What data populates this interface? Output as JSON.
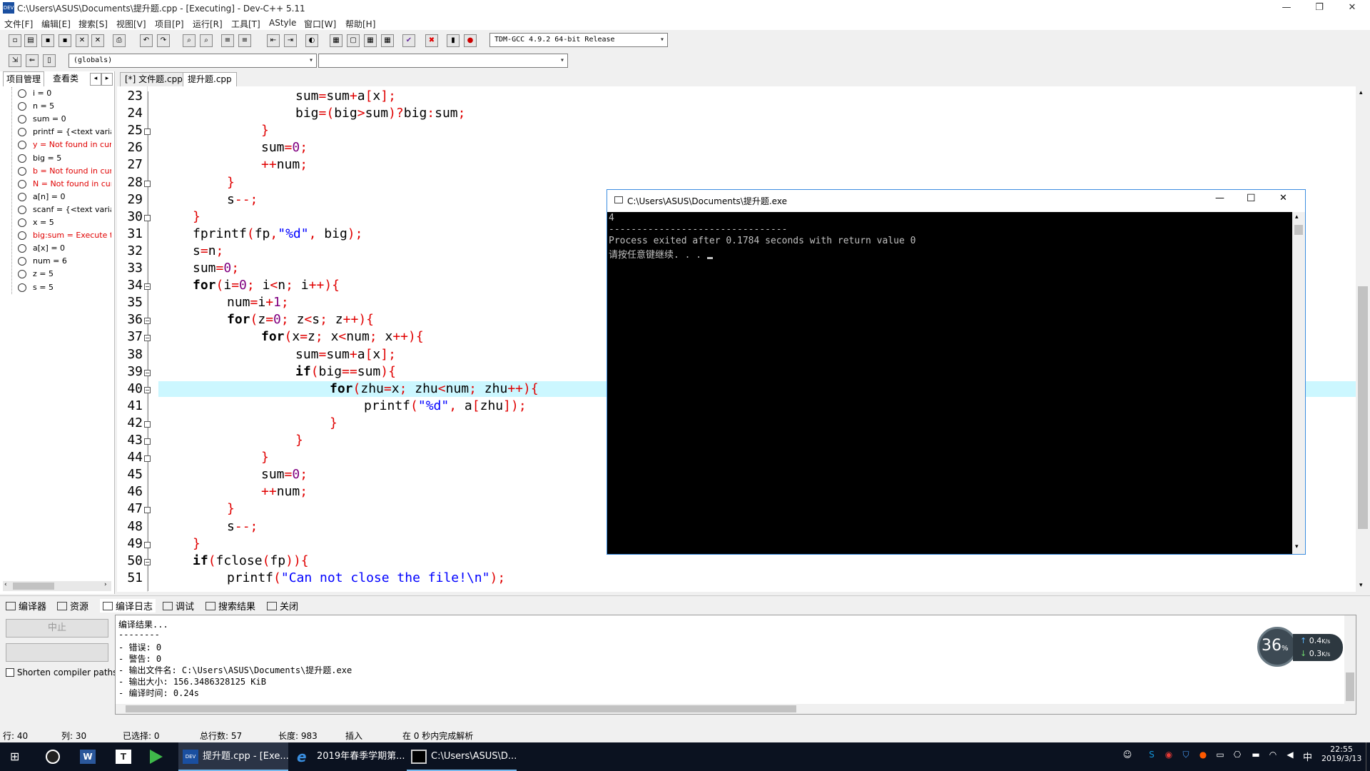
{
  "window": {
    "title": "C:\\Users\\ASUS\\Documents\\提升题.cpp - [Executing] - Dev-C++ 5.11",
    "minimize": "—",
    "restore": "❐",
    "close": "✕"
  },
  "menu": [
    "文件[F]",
    "编辑[E]",
    "搜索[S]",
    "视图[V]",
    "项目[P]",
    "运行[R]",
    "工具[T]",
    "AStyle",
    "窗口[W]",
    "帮助[H]"
  ],
  "toolbar": {
    "compiler_select": "TDM-GCC 4.9.2 64-bit Release",
    "scope_select": "(globals)",
    "member_select": ""
  },
  "left_panel": {
    "tabs": [
      "项目管理",
      "查看类"
    ],
    "watches": [
      {
        "text": "i = 0",
        "error": false
      },
      {
        "text": "n = 5",
        "error": false
      },
      {
        "text": "sum = 0",
        "error": false
      },
      {
        "text": "printf = {<text variab",
        "error": false
      },
      {
        "text": "y = Not found in curr",
        "error": true
      },
      {
        "text": "big = 5",
        "error": false
      },
      {
        "text": "b = Not found in curr",
        "error": true
      },
      {
        "text": "N = Not found in curr",
        "error": true
      },
      {
        "text": "a[n] = 0",
        "error": false
      },
      {
        "text": "scanf = {<text variabl",
        "error": false
      },
      {
        "text": "x = 5",
        "error": false
      },
      {
        "text": "big:sum = Execute to",
        "error": true
      },
      {
        "text": "a[x] = 0",
        "error": false
      },
      {
        "text": "num = 6",
        "error": false
      },
      {
        "text": "z = 5",
        "error": false
      },
      {
        "text": "s = 5",
        "error": false
      }
    ]
  },
  "editor": {
    "tabs": [
      {
        "label": "[*] 文件题.cpp",
        "active": false
      },
      {
        "label": "提升题.cpp",
        "active": true
      }
    ],
    "current_line": 40,
    "lines": [
      {
        "n": "23",
        "code": "sum=sum+a[x];"
      },
      {
        "n": "24",
        "code": "big=(big>sum)?big:sum;"
      },
      {
        "n": "25",
        "code": "}"
      },
      {
        "n": "26",
        "code": "sum=0;"
      },
      {
        "n": "27",
        "code": "++num;"
      },
      {
        "n": "28",
        "code": "}"
      },
      {
        "n": "29",
        "code": "s--;"
      },
      {
        "n": "30",
        "code": "}"
      },
      {
        "n": "31",
        "code": "fprintf(fp,\"%d\", big);"
      },
      {
        "n": "32",
        "code": "s=n;"
      },
      {
        "n": "33",
        "code": "sum=0;"
      },
      {
        "n": "34",
        "code": "for(i=0; i<n; i++){"
      },
      {
        "n": "35",
        "code": "num=i+1;"
      },
      {
        "n": "36",
        "code": "for(z=0; z<s; z++){"
      },
      {
        "n": "37",
        "code": "for(x=z; x<num; x++){"
      },
      {
        "n": "38",
        "code": "sum=sum+a[x];"
      },
      {
        "n": "39",
        "code": "if(big==sum){"
      },
      {
        "n": "40",
        "code": "for(zhu=x; zhu<num; zhu++){"
      },
      {
        "n": "41",
        "code": "printf(\"%d\", a[zhu]);"
      },
      {
        "n": "42",
        "code": "}"
      },
      {
        "n": "43",
        "code": "}"
      },
      {
        "n": "44",
        "code": "}"
      },
      {
        "n": "45",
        "code": "sum=0;"
      },
      {
        "n": "46",
        "code": "++num;"
      },
      {
        "n": "47",
        "code": "}"
      },
      {
        "n": "48",
        "code": "s--;"
      },
      {
        "n": "49",
        "code": "}"
      },
      {
        "n": "50",
        "code": "if(fclose(fp)){"
      },
      {
        "n": "51",
        "code": "printf(\"Can not close the file!\\n\");"
      }
    ]
  },
  "console": {
    "title": "C:\\Users\\ASUS\\Documents\\提升题.exe",
    "lines": [
      "4",
      "--------------------------------",
      "Process exited after 0.1784 seconds with return value 0",
      "请按任意键继续. . . "
    ]
  },
  "bottom_tabs": [
    "编译器",
    "资源",
    "编译日志",
    "调试",
    "搜索结果",
    "关闭"
  ],
  "bottom_left": {
    "abort_button": "中止",
    "shorten_checkbox": "Shorten compiler paths"
  },
  "compile_log": [
    "编译结果...",
    "--------",
    "- 错误: 0",
    "- 警告: 0",
    "- 输出文件名: C:\\Users\\ASUS\\Documents\\提升题.exe",
    "- 输出大小: 156.3486328125 KiB",
    "- 编译时间: 0.24s"
  ],
  "net_widget": {
    "percent": "36",
    "percent_sign": "%",
    "up": "0.4",
    "down": "0.3",
    "unit": "K/s"
  },
  "status_bar": {
    "row_label": "行:",
    "row_value": "40",
    "col_label": "列:",
    "col_value": "30",
    "sel_label": "已选择:",
    "sel_value": "0",
    "total_label": "总行数:",
    "total_value": "57",
    "len_label": "长度:",
    "len_value": "983",
    "mode": "插入",
    "parse": "在 0 秒内完成解析"
  },
  "taskbar": {
    "tasks": [
      {
        "label": "提升题.cpp - [Exe...",
        "active": true
      },
      {
        "label": "2019年春季学期第...",
        "active": false
      },
      {
        "label": "C:\\Users\\ASUS\\D...",
        "active": false
      }
    ],
    "ime": "中",
    "time": "22:55",
    "date": "2019/3/13"
  }
}
